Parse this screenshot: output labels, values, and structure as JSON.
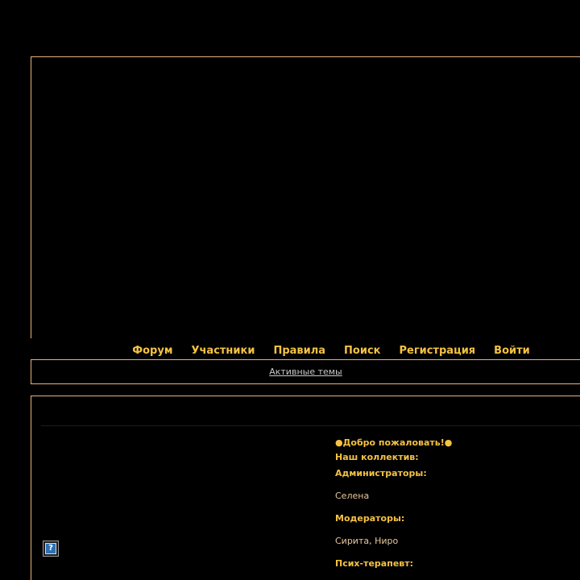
{
  "nav": {
    "items": [
      "Форум",
      "Участники",
      "Правила",
      "Поиск",
      "Регистрация",
      "Войти"
    ]
  },
  "subbar": {
    "active_topics": "Активные темы"
  },
  "info": {
    "welcome": "●Добро пожаловать!●",
    "team_heading": "Наш коллектив:",
    "admins_heading": "Администраторы:",
    "admins": "Селена",
    "mods_heading": "Модераторы:",
    "mods": "Сирита, Ниро",
    "psych_heading": "Псих-терапевт:"
  },
  "icons": {
    "help": "help-icon"
  },
  "colors": {
    "background": "#000000",
    "accent_border": "#e8b27a",
    "nav_text": "#f5c242",
    "link_text": "#c8c8c8",
    "plain_text": "#e8c8a0"
  }
}
